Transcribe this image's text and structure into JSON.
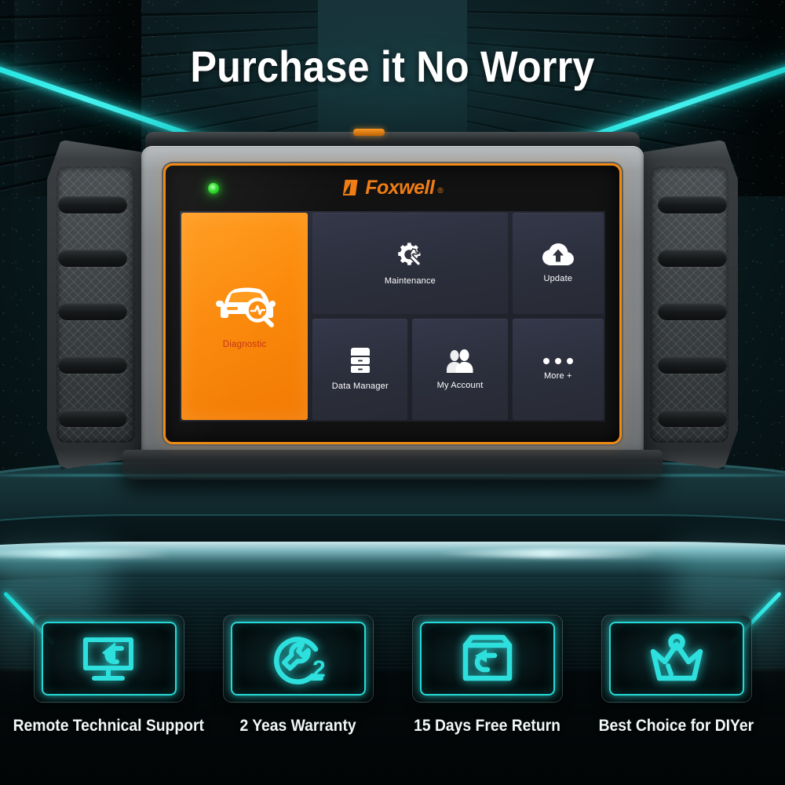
{
  "headline": "Purchase it No Worry",
  "device": {
    "brand": "Foxwell",
    "brand_reg": "®",
    "status_led": "power-on",
    "accent_orange": "#f08a12",
    "screen": {
      "tiles": [
        {
          "id": "diagnostic",
          "label": "Diagnostic",
          "icon": "car-scan-icon",
          "highlight": true
        },
        {
          "id": "maintenance",
          "label": "Maintenance",
          "icon": "gear-wrench-icon",
          "highlight": false
        },
        {
          "id": "update",
          "label": "Update",
          "icon": "cloud-upload-icon",
          "highlight": false
        },
        {
          "id": "data",
          "label": "Data Manager",
          "icon": "drawer-stack-icon",
          "highlight": false
        },
        {
          "id": "account",
          "label": "My Account",
          "icon": "users-icon",
          "highlight": false
        },
        {
          "id": "more",
          "label": "More +",
          "icon": "ellipsis-icon",
          "highlight": false
        }
      ]
    }
  },
  "badges": [
    {
      "caption": "Remote Technical Support",
      "icon": "monitor-back-arrow-icon"
    },
    {
      "caption": "2 Yeas Warranty",
      "icon": "wrench-circle-2-icon"
    },
    {
      "caption": "15 Days Free Return",
      "icon": "box-return-arrow-icon"
    },
    {
      "caption": "Best Choice for DIYer",
      "icon": "crown-icon"
    }
  ],
  "colors": {
    "neon_cyan": "#2ee6e3",
    "brand_orange": "#f07d14",
    "diagnostic_label": "#c7341a",
    "led_green": "#2bdd2b"
  }
}
